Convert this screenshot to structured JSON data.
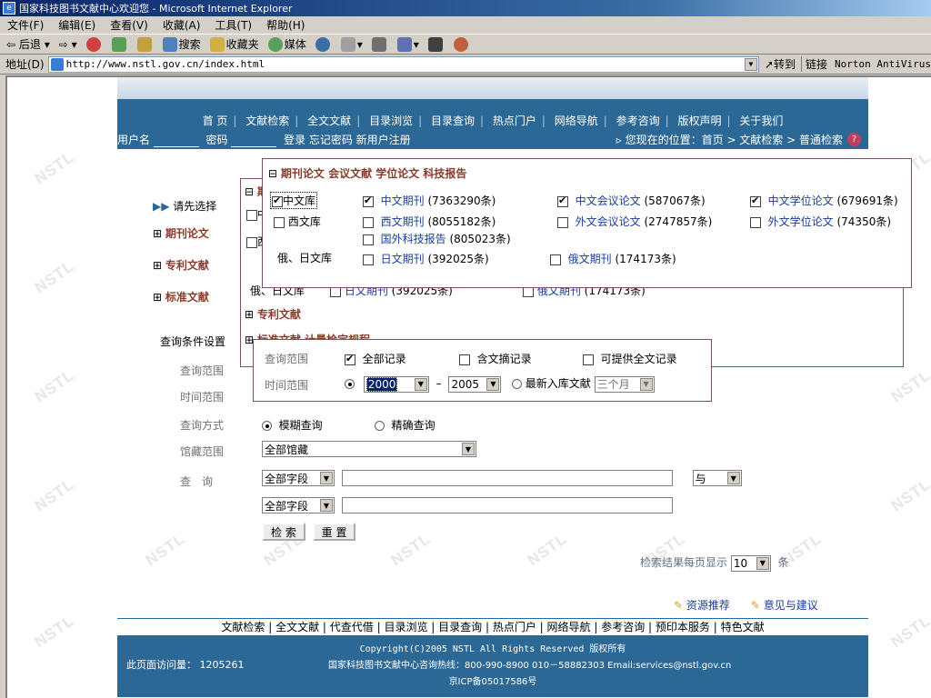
{
  "window": {
    "title": "国家科技图书文献中心欢迎您 - Microsoft Internet Explorer"
  },
  "menubar": [
    "文件(F)",
    "编辑(E)",
    "查看(V)",
    "收藏(A)",
    "工具(T)",
    "帮助(H)"
  ],
  "toolbar": {
    "back": "后退",
    "search": "搜索",
    "favorites": "收藏夹",
    "media": "媒体"
  },
  "address": {
    "label": "地址(D)",
    "url": "http://www.nstl.gov.cn/index.html",
    "go": "转到",
    "links": "链接",
    "norton": "Norton AntiVirus"
  },
  "watermark": "NSTL",
  "nav": {
    "items": [
      "首 页",
      "文献检索",
      "全文文献",
      "目录浏览",
      "目录查询",
      "热点门户",
      "网络导航",
      "参考咨询",
      "版权声明",
      "关于我们"
    ]
  },
  "login": {
    "username": "用户名",
    "password": "密码",
    "login": "登录",
    "forgot": "忘记密码",
    "register": "新用户注册",
    "location": "您现在的位置：首页 > 文献检索 > 普通检索"
  },
  "side": {
    "please_select": "请先选择",
    "journal": "期刊论文",
    "patent": "专利文献",
    "standard": "标准文献"
  },
  "panel1": {
    "tabs": "期刊论文 会议文献 学位论文 科技报告",
    "rows": [
      {
        "lib": "中文库",
        "items": [
          {
            "label": "中文期刊",
            "count": "(7363290条)",
            "checked": true
          },
          {
            "label": "中文会议论文",
            "count": "(587067条)",
            "checked": true
          },
          {
            "label": "中文学位论文",
            "count": "(679691条)",
            "checked": true
          }
        ]
      },
      {
        "lib": "西文库",
        "items": [
          {
            "label": "西文期刊",
            "count": "(8055182条)",
            "checked": false
          },
          {
            "label": "外文会议论文",
            "count": "(2747857条)",
            "checked": false
          },
          {
            "label": "外文学位论文",
            "count": "(74350条)",
            "checked": false
          }
        ]
      },
      {
        "lib": "",
        "items": [
          {
            "label": "国外科技报告",
            "count": "(805023条)",
            "checked": false
          }
        ]
      },
      {
        "lib": "俄、日文库",
        "items": [
          {
            "label": "日文期刊",
            "count": "(392025条)",
            "checked": false
          },
          {
            "label": "俄文期刊",
            "count": "(174173条)",
            "checked": false
          }
        ]
      }
    ]
  },
  "panel2": {
    "head": "期",
    "lib_c": "中",
    "lib_w": "西",
    "ruja_lib": "俄、日文库",
    "ruja_j": "日文期刊",
    "ruja_jc": "(392025条)",
    "ruja_r": "俄文期刊",
    "ruja_rc": "(174173条)",
    "patent": "专利文献",
    "standard": "标准文献 计量检定规程"
  },
  "conditions": {
    "title": "查询条件设置",
    "scope_label": "查询范围",
    "time_label": "时间范围",
    "mode_label": "查询方式",
    "holdings_label": "馆藏范围",
    "query_label": "查　询"
  },
  "panel3": {
    "scope_label": "查询范围",
    "all": "全部记录",
    "abstract": "含文摘记录",
    "fulltext": "可提供全文记录",
    "time_label": "时间范围",
    "from_year": "2000",
    "dash": "–",
    "to_year": "2005",
    "newest": "最新入库文献",
    "newest_sel": "三个月"
  },
  "form": {
    "fuzzy": "模糊查询",
    "exact": "精确查询",
    "holdings": "全部馆藏",
    "field1": "全部字段",
    "field2": "全部字段",
    "logic": "与",
    "search_btn": "检 索",
    "reset_btn": "重 置",
    "per_page_label": "检索结果每页显示",
    "per_page": "10",
    "per_page_unit": "条"
  },
  "links": {
    "recommend": "资源推荐",
    "feedback": "意见与建议"
  },
  "footer": {
    "nav": [
      "文献检索",
      "全文文献",
      "代查代借",
      "目录浏览",
      "目录查询",
      "热点门户",
      "网络导航",
      "参考咨询",
      "预印本服务",
      "特色文献"
    ],
    "copyright": "Copyright(C)2005 NSTL All Rights Reserved 版权所有",
    "visits_label": "此页面访问量：",
    "visits": "1205261",
    "hotline": "国家科技图书文献中心咨询热线：800-990-8900 010－58882303 Email:services@nstl.gov.cn",
    "icp": "京ICP备05017586号"
  },
  "colors": {
    "nav_blue": "#2c6896",
    "panel_border": "#7a5070",
    "link": "#1a3c9a",
    "label_brown": "#8a3a2a"
  }
}
